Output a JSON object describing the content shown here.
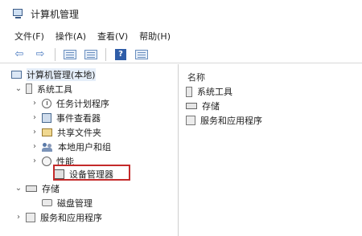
{
  "window": {
    "title": "计算机管理"
  },
  "menu": [
    "文件(F)",
    "操作(A)",
    "查看(V)",
    "帮助(H)"
  ],
  "toolbar": {
    "buttons": [
      {
        "name": "back-arrow-icon",
        "glyph": "⇦"
      },
      {
        "name": "forward-arrow-icon",
        "glyph": "⇨"
      },
      {
        "name": "show-tree-icon"
      },
      {
        "name": "export-list-icon"
      },
      {
        "name": "help-icon",
        "glyph": "?"
      },
      {
        "name": "properties-icon"
      }
    ]
  },
  "tree": {
    "root": "计算机管理(本地)",
    "system_tools": "系统工具",
    "task_scheduler": "任务计划程序",
    "event_viewer": "事件查看器",
    "shared_folders": "共享文件夹",
    "local_users": "本地用户和组",
    "performance": "性能",
    "device_manager": "设备管理器",
    "storage": "存储",
    "disk_management": "磁盘管理",
    "services_apps": "服务和应用程序"
  },
  "right_pane": {
    "column_header": "名称",
    "items": [
      "系统工具",
      "存储",
      "服务和应用程序"
    ]
  },
  "colors": {
    "highlight_border": "#c42a2a",
    "icon_blue": "#4a7ac0"
  }
}
